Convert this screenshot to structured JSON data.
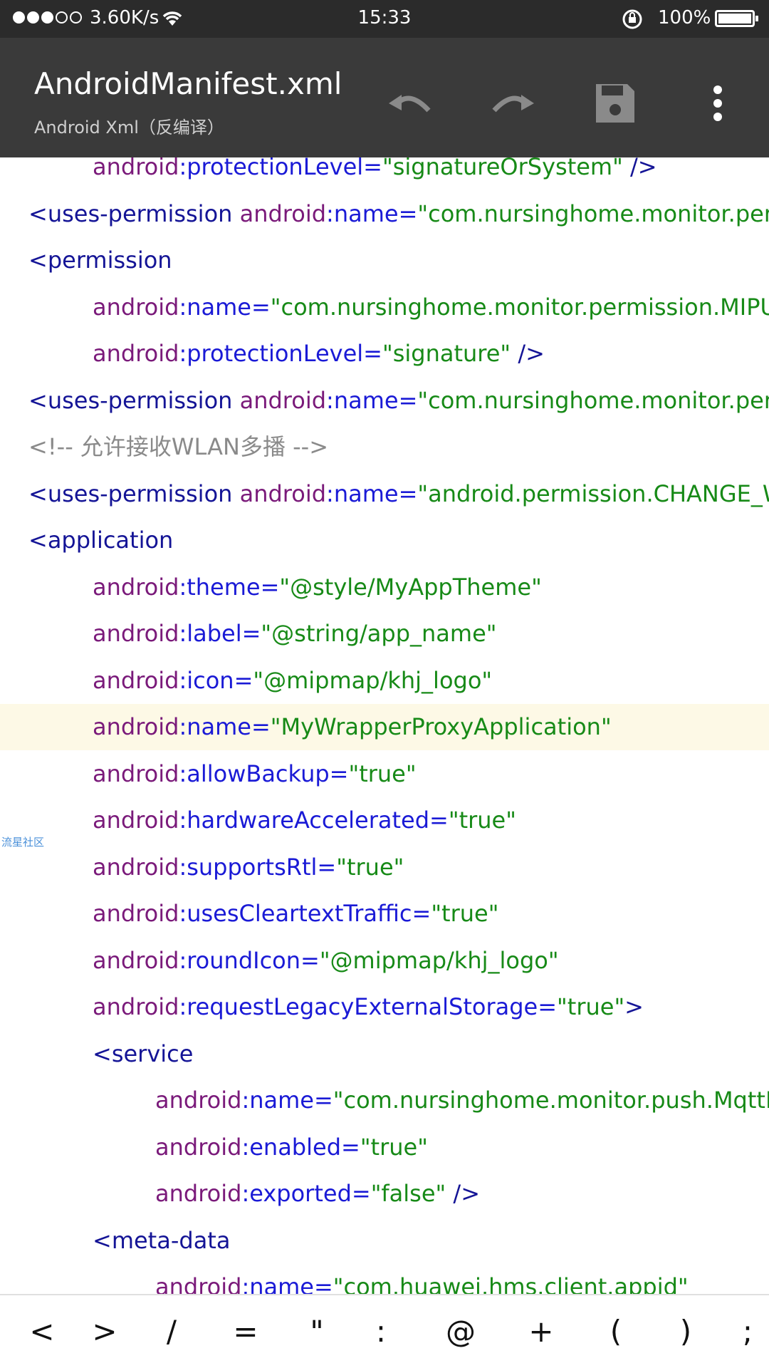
{
  "status_bar": {
    "speed": "3.60K/s",
    "time": "15:33",
    "battery": "100%"
  },
  "app_bar": {
    "title": "AndroidManifest.xml",
    "subtitle": "Android  Xml（反编译）",
    "icons": [
      "undo-icon",
      "redo-icon",
      "save-icon",
      "more-icon"
    ]
  },
  "editor": {
    "lines": [
      {
        "indent": 2,
        "highlight": false,
        "tokens": [
          {
            "t": "ns",
            "v": "android"
          },
          {
            "t": "attr",
            "v": ":protectionLevel="
          },
          {
            "t": "val",
            "v": "\"signatureOrSystem\""
          },
          {
            "t": "tag",
            "v": " />"
          }
        ]
      },
      {
        "indent": 1,
        "highlight": false,
        "tokens": [
          {
            "t": "tag",
            "v": "<uses-permission "
          },
          {
            "t": "ns",
            "v": "android"
          },
          {
            "t": "attr",
            "v": ":name="
          },
          {
            "t": "val",
            "v": "\"com.nursinghome.monitor.permission.PR"
          }
        ]
      },
      {
        "indent": 1,
        "highlight": false,
        "tokens": [
          {
            "t": "tag",
            "v": "<permission"
          }
        ]
      },
      {
        "indent": 2,
        "highlight": false,
        "tokens": [
          {
            "t": "ns",
            "v": "android"
          },
          {
            "t": "attr",
            "v": ":name="
          },
          {
            "t": "val",
            "v": "\"com.nursinghome.monitor.permission.MIPUSH_REC"
          }
        ]
      },
      {
        "indent": 2,
        "highlight": false,
        "tokens": [
          {
            "t": "ns",
            "v": "android"
          },
          {
            "t": "attr",
            "v": ":protectionLevel="
          },
          {
            "t": "val",
            "v": "\"signature\""
          },
          {
            "t": "tag",
            "v": " />"
          }
        ]
      },
      {
        "indent": 1,
        "highlight": false,
        "tokens": [
          {
            "t": "tag",
            "v": "<uses-permission "
          },
          {
            "t": "ns",
            "v": "android"
          },
          {
            "t": "attr",
            "v": ":name="
          },
          {
            "t": "val",
            "v": "\"com.nursinghome.monitor.permission.M"
          }
        ]
      },
      {
        "indent": 1,
        "highlight": false,
        "tokens": [
          {
            "t": "comment",
            "v": "<!-- 允许接收WLAN多播 -->"
          }
        ]
      },
      {
        "indent": 1,
        "highlight": false,
        "tokens": [
          {
            "t": "tag",
            "v": "<uses-permission "
          },
          {
            "t": "ns",
            "v": "android"
          },
          {
            "t": "attr",
            "v": ":name="
          },
          {
            "t": "val",
            "v": "\"android.permission.CHANGE_WIFI_MU"
          }
        ]
      },
      {
        "indent": 1,
        "highlight": false,
        "tokens": [
          {
            "t": "tag",
            "v": "<application"
          }
        ]
      },
      {
        "indent": 2,
        "highlight": false,
        "tokens": [
          {
            "t": "ns",
            "v": "android"
          },
          {
            "t": "attr",
            "v": ":theme="
          },
          {
            "t": "val",
            "v": "\"@style/MyAppTheme\""
          }
        ]
      },
      {
        "indent": 2,
        "highlight": false,
        "tokens": [
          {
            "t": "ns",
            "v": "android"
          },
          {
            "t": "attr",
            "v": ":label="
          },
          {
            "t": "val",
            "v": "\"@string/app_name\""
          }
        ]
      },
      {
        "indent": 2,
        "highlight": false,
        "tokens": [
          {
            "t": "ns",
            "v": "android"
          },
          {
            "t": "attr",
            "v": ":icon="
          },
          {
            "t": "val",
            "v": "\"@mipmap/khj_logo\""
          }
        ]
      },
      {
        "indent": 2,
        "highlight": true,
        "tokens": [
          {
            "t": "ns",
            "v": "android"
          },
          {
            "t": "attr",
            "v": ":name="
          },
          {
            "t": "val",
            "v": "\"MyWrapperProxyApplication\""
          }
        ]
      },
      {
        "indent": 2,
        "highlight": false,
        "tokens": [
          {
            "t": "ns",
            "v": "android"
          },
          {
            "t": "attr",
            "v": ":allowBackup="
          },
          {
            "t": "val",
            "v": "\"true\""
          }
        ]
      },
      {
        "indent": 2,
        "highlight": false,
        "tokens": [
          {
            "t": "ns",
            "v": "android"
          },
          {
            "t": "attr",
            "v": ":hardwareAccelerated="
          },
          {
            "t": "val",
            "v": "\"true\""
          }
        ]
      },
      {
        "indent": 2,
        "highlight": false,
        "tokens": [
          {
            "t": "ns",
            "v": "android"
          },
          {
            "t": "attr",
            "v": ":supportsRtl="
          },
          {
            "t": "val",
            "v": "\"true\""
          }
        ]
      },
      {
        "indent": 2,
        "highlight": false,
        "tokens": [
          {
            "t": "ns",
            "v": "android"
          },
          {
            "t": "attr",
            "v": ":usesCleartextTraffic="
          },
          {
            "t": "val",
            "v": "\"true\""
          }
        ]
      },
      {
        "indent": 2,
        "highlight": false,
        "tokens": [
          {
            "t": "ns",
            "v": "android"
          },
          {
            "t": "attr",
            "v": ":roundIcon="
          },
          {
            "t": "val",
            "v": "\"@mipmap/khj_logo\""
          }
        ]
      },
      {
        "indent": 2,
        "highlight": false,
        "tokens": [
          {
            "t": "ns",
            "v": "android"
          },
          {
            "t": "attr",
            "v": ":requestLegacyExternalStorage="
          },
          {
            "t": "val",
            "v": "\"true\""
          },
          {
            "t": "tag",
            "v": ">"
          }
        ]
      },
      {
        "indent": 2,
        "highlight": false,
        "tokens": [
          {
            "t": "tag",
            "v": "<service"
          }
        ]
      },
      {
        "indent": 3,
        "highlight": false,
        "tokens": [
          {
            "t": "ns",
            "v": "android"
          },
          {
            "t": "attr",
            "v": ":name="
          },
          {
            "t": "val",
            "v": "\"com.nursinghome.monitor.push.MqttPushServi"
          }
        ]
      },
      {
        "indent": 3,
        "highlight": false,
        "tokens": [
          {
            "t": "ns",
            "v": "android"
          },
          {
            "t": "attr",
            "v": ":enabled="
          },
          {
            "t": "val",
            "v": "\"true\""
          }
        ]
      },
      {
        "indent": 3,
        "highlight": false,
        "tokens": [
          {
            "t": "ns",
            "v": "android"
          },
          {
            "t": "attr",
            "v": ":exported="
          },
          {
            "t": "val",
            "v": "\"false\""
          },
          {
            "t": "tag",
            "v": " />"
          }
        ]
      },
      {
        "indent": 2,
        "highlight": false,
        "tokens": [
          {
            "t": "tag",
            "v": "<meta-data"
          }
        ]
      },
      {
        "indent": 3,
        "highlight": false,
        "tokens": [
          {
            "t": "ns",
            "v": "android"
          },
          {
            "t": "attr",
            "v": ":name="
          },
          {
            "t": "val",
            "v": "\"com.huawei.hms.client.appid\""
          }
        ]
      }
    ],
    "watermark": "流星社区"
  },
  "symbol_bar": {
    "keys": [
      "<",
      ">",
      "/",
      "=",
      "\"",
      ":",
      "@",
      "+",
      "(",
      ")",
      ";"
    ]
  },
  "colors": {
    "tag": "#141496",
    "namespace": "#7a1a7a",
    "attribute": "#1a1ad6",
    "value": "#178a17",
    "comment": "#8a8a8a",
    "highlight": "#fdf9e6",
    "app_bar": "#3a3a3a",
    "status_bar": "#2b2b2b"
  }
}
